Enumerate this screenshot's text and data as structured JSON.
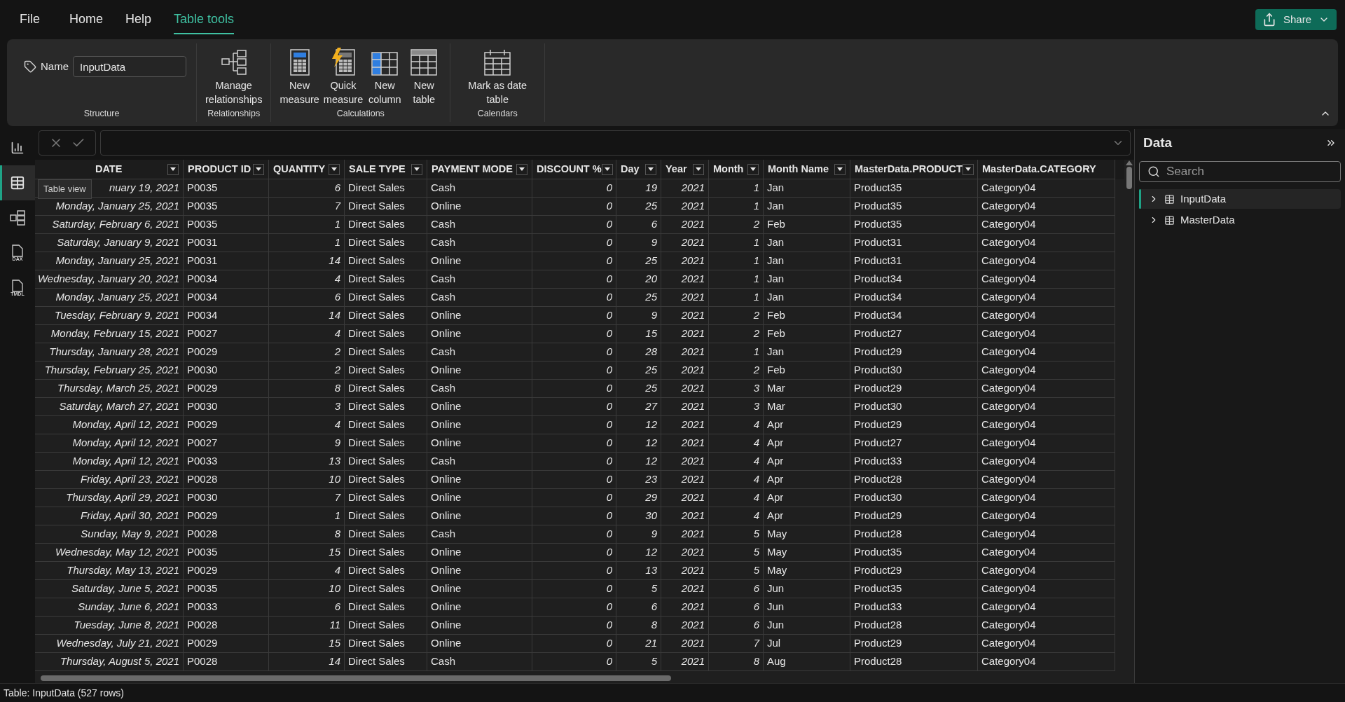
{
  "menu": [
    {
      "label": "File",
      "selected": false
    },
    {
      "label": "Home",
      "selected": false
    },
    {
      "label": "Help",
      "selected": false
    },
    {
      "label": "Table tools",
      "selected": true
    }
  ],
  "share_button": {
    "label": "Share"
  },
  "ribbon": {
    "groups": [
      {
        "label": "Structure",
        "kind": "name",
        "field_label": "Name",
        "value": "InputData"
      },
      {
        "label": "Relationships",
        "kind": "buttons",
        "buttons": [
          {
            "kind": "relationships",
            "label": "Manage relationships"
          }
        ]
      },
      {
        "label": "Calculations",
        "kind": "buttons",
        "buttons": [
          {
            "kind": "measure",
            "label": "New measure"
          },
          {
            "kind": "quick",
            "label": "Quick measure"
          },
          {
            "kind": "column",
            "label": "New column"
          },
          {
            "kind": "table",
            "label": "New table"
          }
        ]
      },
      {
        "label": "Calendars",
        "kind": "buttons",
        "buttons": [
          {
            "kind": "calendar",
            "label": "Mark as date table"
          }
        ]
      }
    ]
  },
  "rail": [
    {
      "kind": "report",
      "selected": false
    },
    {
      "kind": "table",
      "selected": true
    },
    {
      "kind": "model",
      "selected": false
    },
    {
      "kind": "doc",
      "label": "DAX",
      "selected": false
    },
    {
      "kind": "doc",
      "label": "TMDL",
      "selected": false
    }
  ],
  "tooltip": "Table view",
  "table": {
    "columns": [
      {
        "label": "DATE",
        "kind": "date"
      },
      {
        "label": "PRODUCT ID",
        "kind": "text"
      },
      {
        "label": "QUANTITY",
        "kind": "number"
      },
      {
        "label": "SALE TYPE",
        "kind": "text"
      },
      {
        "label": "PAYMENT MODE",
        "kind": "text"
      },
      {
        "label": "DISCOUNT %",
        "kind": "number"
      },
      {
        "label": "Day",
        "kind": "number"
      },
      {
        "label": "Year",
        "kind": "number"
      },
      {
        "label": "Month",
        "kind": "number"
      },
      {
        "label": "Month Name",
        "kind": "text"
      },
      {
        "label": "MasterData.PRODUCT",
        "kind": "text"
      },
      {
        "label": "MasterData.CATEGORY",
        "kind": "text"
      }
    ],
    "rows": [
      [
        "nuary 19, 2021",
        "P0035",
        "6",
        "Direct Sales",
        "Cash",
        "0",
        "19",
        "2021",
        "1",
        "Jan",
        "Product35",
        "Category04"
      ],
      [
        "Monday, January 25, 2021",
        "P0035",
        "7",
        "Direct Sales",
        "Online",
        "0",
        "25",
        "2021",
        "1",
        "Jan",
        "Product35",
        "Category04"
      ],
      [
        "Saturday, February 6, 2021",
        "P0035",
        "1",
        "Direct Sales",
        "Cash",
        "0",
        "6",
        "2021",
        "2",
        "Feb",
        "Product35",
        "Category04"
      ],
      [
        "Saturday, January 9, 2021",
        "P0031",
        "1",
        "Direct Sales",
        "Cash",
        "0",
        "9",
        "2021",
        "1",
        "Jan",
        "Product31",
        "Category04"
      ],
      [
        "Monday, January 25, 2021",
        "P0031",
        "14",
        "Direct Sales",
        "Online",
        "0",
        "25",
        "2021",
        "1",
        "Jan",
        "Product31",
        "Category04"
      ],
      [
        "Wednesday, January 20, 2021",
        "P0034",
        "4",
        "Direct Sales",
        "Cash",
        "0",
        "20",
        "2021",
        "1",
        "Jan",
        "Product34",
        "Category04"
      ],
      [
        "Monday, January 25, 2021",
        "P0034",
        "6",
        "Direct Sales",
        "Cash",
        "0",
        "25",
        "2021",
        "1",
        "Jan",
        "Product34",
        "Category04"
      ],
      [
        "Tuesday, February 9, 2021",
        "P0034",
        "14",
        "Direct Sales",
        "Online",
        "0",
        "9",
        "2021",
        "2",
        "Feb",
        "Product34",
        "Category04"
      ],
      [
        "Monday, February 15, 2021",
        "P0027",
        "4",
        "Direct Sales",
        "Online",
        "0",
        "15",
        "2021",
        "2",
        "Feb",
        "Product27",
        "Category04"
      ],
      [
        "Thursday, January 28, 2021",
        "P0029",
        "2",
        "Direct Sales",
        "Cash",
        "0",
        "28",
        "2021",
        "1",
        "Jan",
        "Product29",
        "Category04"
      ],
      [
        "Thursday, February 25, 2021",
        "P0030",
        "2",
        "Direct Sales",
        "Online",
        "0",
        "25",
        "2021",
        "2",
        "Feb",
        "Product30",
        "Category04"
      ],
      [
        "Thursday, March 25, 2021",
        "P0029",
        "8",
        "Direct Sales",
        "Cash",
        "0",
        "25",
        "2021",
        "3",
        "Mar",
        "Product29",
        "Category04"
      ],
      [
        "Saturday, March 27, 2021",
        "P0030",
        "3",
        "Direct Sales",
        "Online",
        "0",
        "27",
        "2021",
        "3",
        "Mar",
        "Product30",
        "Category04"
      ],
      [
        "Monday, April 12, 2021",
        "P0029",
        "4",
        "Direct Sales",
        "Online",
        "0",
        "12",
        "2021",
        "4",
        "Apr",
        "Product29",
        "Category04"
      ],
      [
        "Monday, April 12, 2021",
        "P0027",
        "9",
        "Direct Sales",
        "Online",
        "0",
        "12",
        "2021",
        "4",
        "Apr",
        "Product27",
        "Category04"
      ],
      [
        "Monday, April 12, 2021",
        "P0033",
        "13",
        "Direct Sales",
        "Cash",
        "0",
        "12",
        "2021",
        "4",
        "Apr",
        "Product33",
        "Category04"
      ],
      [
        "Friday, April 23, 2021",
        "P0028",
        "10",
        "Direct Sales",
        "Online",
        "0",
        "23",
        "2021",
        "4",
        "Apr",
        "Product28",
        "Category04"
      ],
      [
        "Thursday, April 29, 2021",
        "P0030",
        "7",
        "Direct Sales",
        "Online",
        "0",
        "29",
        "2021",
        "4",
        "Apr",
        "Product30",
        "Category04"
      ],
      [
        "Friday, April 30, 2021",
        "P0029",
        "1",
        "Direct Sales",
        "Online",
        "0",
        "30",
        "2021",
        "4",
        "Apr",
        "Product29",
        "Category04"
      ],
      [
        "Sunday, May 9, 2021",
        "P0028",
        "8",
        "Direct Sales",
        "Cash",
        "0",
        "9",
        "2021",
        "5",
        "May",
        "Product28",
        "Category04"
      ],
      [
        "Wednesday, May 12, 2021",
        "P0035",
        "15",
        "Direct Sales",
        "Online",
        "0",
        "12",
        "2021",
        "5",
        "May",
        "Product35",
        "Category04"
      ],
      [
        "Thursday, May 13, 2021",
        "P0029",
        "4",
        "Direct Sales",
        "Online",
        "0",
        "13",
        "2021",
        "5",
        "May",
        "Product29",
        "Category04"
      ],
      [
        "Saturday, June 5, 2021",
        "P0035",
        "10",
        "Direct Sales",
        "Online",
        "0",
        "5",
        "2021",
        "6",
        "Jun",
        "Product35",
        "Category04"
      ],
      [
        "Sunday, June 6, 2021",
        "P0033",
        "6",
        "Direct Sales",
        "Online",
        "0",
        "6",
        "2021",
        "6",
        "Jun",
        "Product33",
        "Category04"
      ],
      [
        "Tuesday, June 8, 2021",
        "P0028",
        "11",
        "Direct Sales",
        "Online",
        "0",
        "8",
        "2021",
        "6",
        "Jun",
        "Product28",
        "Category04"
      ],
      [
        "Wednesday, July 21, 2021",
        "P0029",
        "15",
        "Direct Sales",
        "Online",
        "0",
        "21",
        "2021",
        "7",
        "Jul",
        "Product29",
        "Category04"
      ],
      [
        "Thursday, August 5, 2021",
        "P0028",
        "14",
        "Direct Sales",
        "Cash",
        "0",
        "5",
        "2021",
        "8",
        "Aug",
        "Product28",
        "Category04"
      ]
    ]
  },
  "data_panel": {
    "title": "Data",
    "search": {
      "placeholder": "Search"
    },
    "items": [
      {
        "label": "InputData",
        "selected": true,
        "expanded": false
      },
      {
        "label": "MasterData",
        "selected": false,
        "expanded": false
      }
    ]
  },
  "status_bar": "Table: InputData (527 rows)"
}
